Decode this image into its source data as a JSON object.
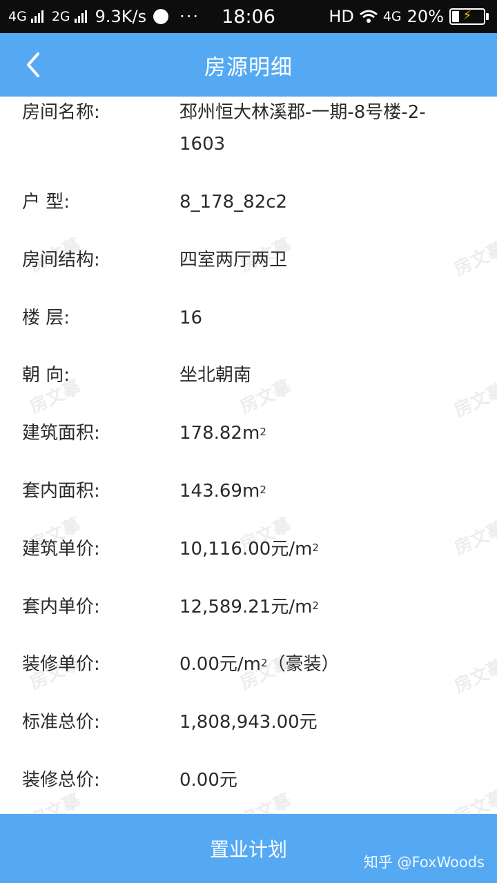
{
  "status_bar": {
    "net1": "4G",
    "net2": "2G",
    "speed": "9.3K/s",
    "more": "···",
    "time": "18:06",
    "hd": "HD",
    "net3": "4G",
    "battery": "20%"
  },
  "header": {
    "title": "房源明细"
  },
  "details": [
    {
      "label": "房间名称:",
      "value": "邳州恒大林溪郡-一期-8号楼-2-1603"
    },
    {
      "label": "户    型:",
      "value": "8_178_82c2"
    },
    {
      "label": "房间结构:",
      "value": "四室两厅两卫"
    },
    {
      "label": "楼    层:",
      "value": "16"
    },
    {
      "label": "朝    向:",
      "value": "坐北朝南"
    },
    {
      "label": "建筑面积:",
      "value": "178.82m²"
    },
    {
      "label": "套内面积:",
      "value": "143.69m²"
    },
    {
      "label": "建筑单价:",
      "value": "10,116.00元/m²"
    },
    {
      "label": "套内单价:",
      "value": "12,589.21元/m²"
    },
    {
      "label": "装修单价:",
      "value": "0.00元/m²（豪装）"
    },
    {
      "label": "标准总价:",
      "value": "1,808,943.00元"
    },
    {
      "label": "装修总价:",
      "value": "0.00元"
    }
  ],
  "watermark_text": "房文摹",
  "footer": {
    "button_label": "置业计划",
    "credit": "知乎 @FoxWoods"
  }
}
